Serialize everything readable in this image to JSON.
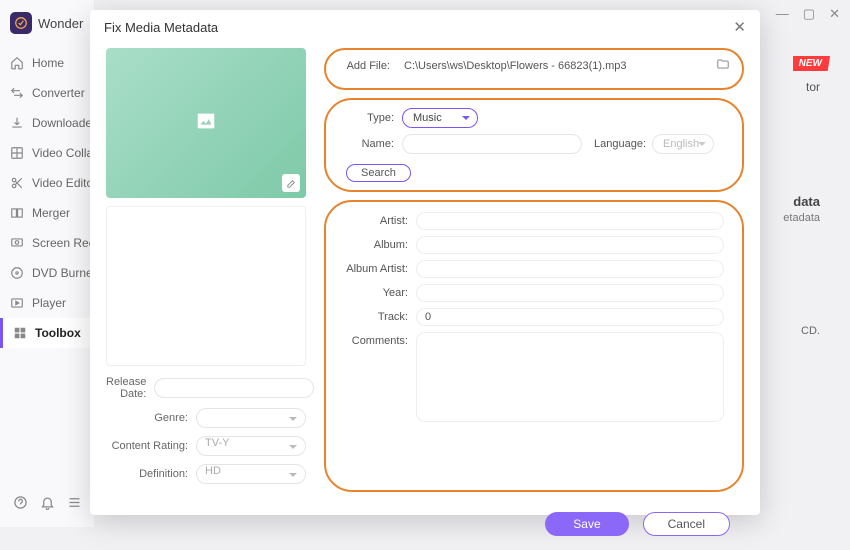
{
  "brand": "Wonder",
  "nav": [
    {
      "label": "Home"
    },
    {
      "label": "Converter"
    },
    {
      "label": "Downloader"
    },
    {
      "label": "Video Collage"
    },
    {
      "label": "Video Editor"
    },
    {
      "label": "Merger"
    },
    {
      "label": "Screen Recorder"
    },
    {
      "label": "DVD Burner"
    },
    {
      "label": "Player"
    },
    {
      "label": "Toolbox"
    }
  ],
  "badge_new": "NEW",
  "bg": {
    "t1": "tor",
    "t2": "data",
    "t3": "etadata",
    "t4": "CD."
  },
  "dialog": {
    "title": "Fix Media Metadata",
    "add_file_label": "Add File:",
    "add_file_value": "C:\\Users\\ws\\Desktop\\Flowers - 66823(1).mp3",
    "type_label": "Type:",
    "type_value": "Music",
    "name_label": "Name:",
    "language_label": "Language:",
    "language_value": "English",
    "search": "Search",
    "artist_label": "Artist:",
    "album_label": "Album:",
    "album_artist_label": "Album Artist:",
    "year_label": "Year:",
    "track_label": "Track:",
    "track_value": "0",
    "comments_label": "Comments:",
    "release_date_label": "Release Date:",
    "genre_label": "Genre:",
    "content_rating_label": "Content Rating:",
    "content_rating_value": "TV-Y",
    "definition_label": "Definition:",
    "definition_value": "HD",
    "save": "Save",
    "cancel": "Cancel"
  }
}
